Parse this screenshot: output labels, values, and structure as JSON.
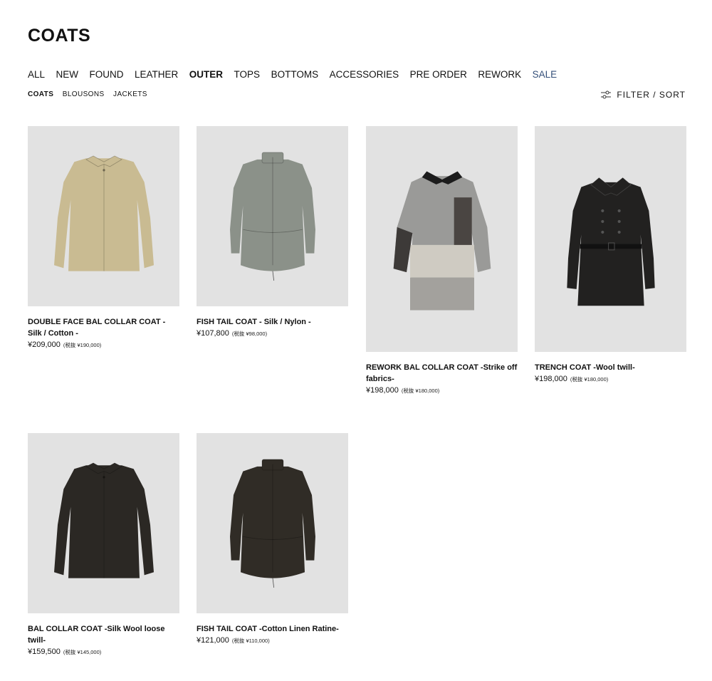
{
  "page": {
    "title": "COATS"
  },
  "main_nav": [
    {
      "label": "ALL",
      "state": ""
    },
    {
      "label": "NEW",
      "state": ""
    },
    {
      "label": "FOUND",
      "state": ""
    },
    {
      "label": "LEATHER",
      "state": ""
    },
    {
      "label": "OUTER",
      "state": "active"
    },
    {
      "label": "TOPS",
      "state": ""
    },
    {
      "label": "BOTTOMS",
      "state": ""
    },
    {
      "label": "ACCESSORIES",
      "state": ""
    },
    {
      "label": "PRE ORDER",
      "state": ""
    },
    {
      "label": "REWORK",
      "state": ""
    },
    {
      "label": "SALE",
      "state": "sale"
    }
  ],
  "sub_nav": [
    {
      "label": "COATS",
      "state": "active"
    },
    {
      "label": "BLOUSONS",
      "state": ""
    },
    {
      "label": "JACKETS",
      "state": ""
    }
  ],
  "filter": {
    "label": "FILTER / SORT",
    "icon": "sliders-icon"
  },
  "colors": {
    "accent_sale": "#35507a",
    "thumb_bg": "#e2e2e2"
  },
  "products": [
    {
      "name": "DOUBLE FACE BAL COLLAR COAT - Silk / Cotton -",
      "price": "¥209,000",
      "tax_note": "(税抜 ¥190,000)",
      "color": "#c9bb92",
      "style": "balcollar"
    },
    {
      "name": "FISH TAIL COAT - Silk / Nylon -",
      "price": "¥107,800",
      "tax_note": "(税抜 ¥98,000)",
      "color": "#8b9189",
      "style": "fishtail"
    },
    {
      "name": "REWORK BAL COLLAR COAT -Strike off fabrics-",
      "price": "¥198,000",
      "tax_note": "(税抜 ¥180,000)",
      "color": "#9a9a98",
      "style": "rework"
    },
    {
      "name": "TRENCH COAT -Wool twill-",
      "price": "¥198,000",
      "tax_note": "(税抜 ¥180,000)",
      "color": "#222120",
      "style": "trench"
    },
    {
      "name": "BAL COLLAR COAT -Silk Wool loose twill-",
      "price": "¥159,500",
      "tax_note": "(税抜 ¥145,000)",
      "color": "#2b2824",
      "style": "balcollar"
    },
    {
      "name": "FISH TAIL COAT -Cotton Linen Ratine-",
      "price": "¥121,000",
      "tax_note": "(税抜 ¥110,000)",
      "color": "#302c26",
      "style": "fishtail"
    }
  ]
}
